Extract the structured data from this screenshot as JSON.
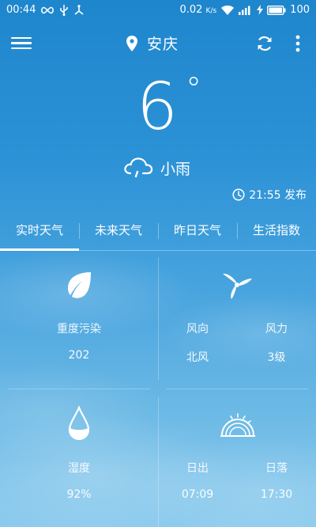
{
  "status_bar": {
    "time": "00:44",
    "net_speed": "0.02",
    "net_unit": "K/s",
    "battery": "100"
  },
  "header": {
    "city": "安庆"
  },
  "current": {
    "temperature": "6",
    "degree_symbol": "°",
    "condition": "小雨",
    "publish_time": "21:55 发布"
  },
  "tabs": [
    {
      "label": "实时天气",
      "active": true
    },
    {
      "label": "未来天气",
      "active": false
    },
    {
      "label": "昨日天气",
      "active": false
    },
    {
      "label": "生活指数",
      "active": false
    }
  ],
  "details": {
    "air": {
      "label": "重度污染",
      "value": "202"
    },
    "wind_direction": {
      "label": "风向",
      "value": "北风"
    },
    "wind_power": {
      "label": "风力",
      "value": "3级"
    },
    "humidity": {
      "label": "湿度",
      "value": "92%"
    },
    "sunrise": {
      "label": "日出",
      "value": "07:09"
    },
    "sunset": {
      "label": "日落",
      "value": "17:30"
    }
  },
  "icons": {
    "menu": "menu-icon",
    "location": "location-pin-icon",
    "refresh": "refresh-icon",
    "more": "more-vertical-icon",
    "condition": "light-rain-icon",
    "clock": "clock-icon",
    "air": "leaf-icon",
    "wind": "wind-turbine-icon",
    "humidity": "water-drop-icon",
    "sun": "sunrise-sunset-icon"
  }
}
